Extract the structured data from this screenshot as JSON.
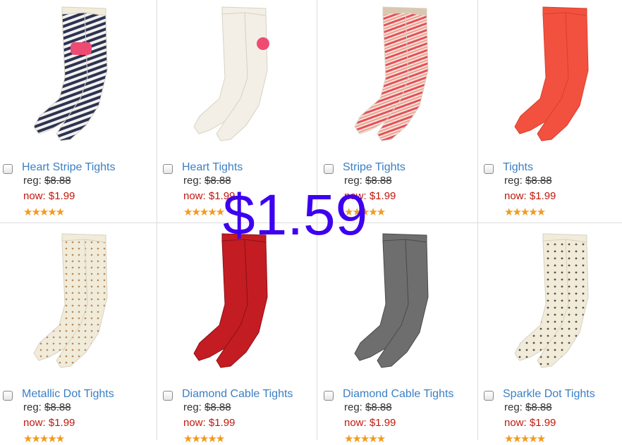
{
  "products": [
    {
      "name": "Heart Stripe Tights",
      "reg_label": "reg:",
      "reg_price": "$8.88",
      "now_label": "now:",
      "now_price": "$1.99",
      "stars": "★★★★★",
      "image": "heart-stripe-tights-image"
    },
    {
      "name": "Heart Tights",
      "reg_label": "reg:",
      "reg_price": "$8.88",
      "now_label": "now:",
      "now_price": "$1.99",
      "stars": "★★★★★",
      "image": "heart-tights-image"
    },
    {
      "name": "Stripe Tights",
      "reg_label": "reg:",
      "reg_price": "$8.88",
      "now_label": "now:",
      "now_price": "$1.99",
      "stars": "★★★★★",
      "image": "stripe-tights-image"
    },
    {
      "name": "Tights",
      "reg_label": "reg:",
      "reg_price": "$8.88",
      "now_label": "now:",
      "now_price": "$1.99",
      "stars": "★★★★★",
      "image": "tights-image"
    },
    {
      "name": "Metallic Dot Tights",
      "reg_label": "reg:",
      "reg_price": "$8.88",
      "now_label": "now:",
      "now_price": "$1.99",
      "stars": "★★★★★",
      "image": "metallic-dot-tights-image"
    },
    {
      "name": "Diamond Cable Tights",
      "reg_label": "reg:",
      "reg_price": "$8.88",
      "now_label": "now:",
      "now_price": "$1.99",
      "stars": "★★★★★",
      "image": "diamond-cable-tights-red-image"
    },
    {
      "name": "Diamond Cable Tights",
      "reg_label": "reg:",
      "reg_price": "$8.88",
      "now_label": "now:",
      "now_price": "$1.99",
      "stars": "★★★★★",
      "image": "diamond-cable-tights-gray-image"
    },
    {
      "name": "Sparkle Dot Tights",
      "reg_label": "reg:",
      "reg_price": "$8.88",
      "now_label": "now:",
      "now_price": "$1.99",
      "stars": "★★★★★",
      "image": "sparkle-dot-tights-image"
    }
  ],
  "overlay_price": "$1.59",
  "colors": {
    "link": "#3b7fc4",
    "sale": "#c0170b",
    "star": "#f39a1e",
    "overlay": "#3d00f0",
    "tights_white": "#f3efe6",
    "tights_navy": "#2e3350",
    "tights_pink": "#ee4b73",
    "tights_coral": "#f2513f",
    "tights_red": "#c41c23",
    "tights_gray": "#6e6e6e",
    "tights_cream": "#f1ebd9",
    "tights_oat": "#d9c7b0"
  }
}
